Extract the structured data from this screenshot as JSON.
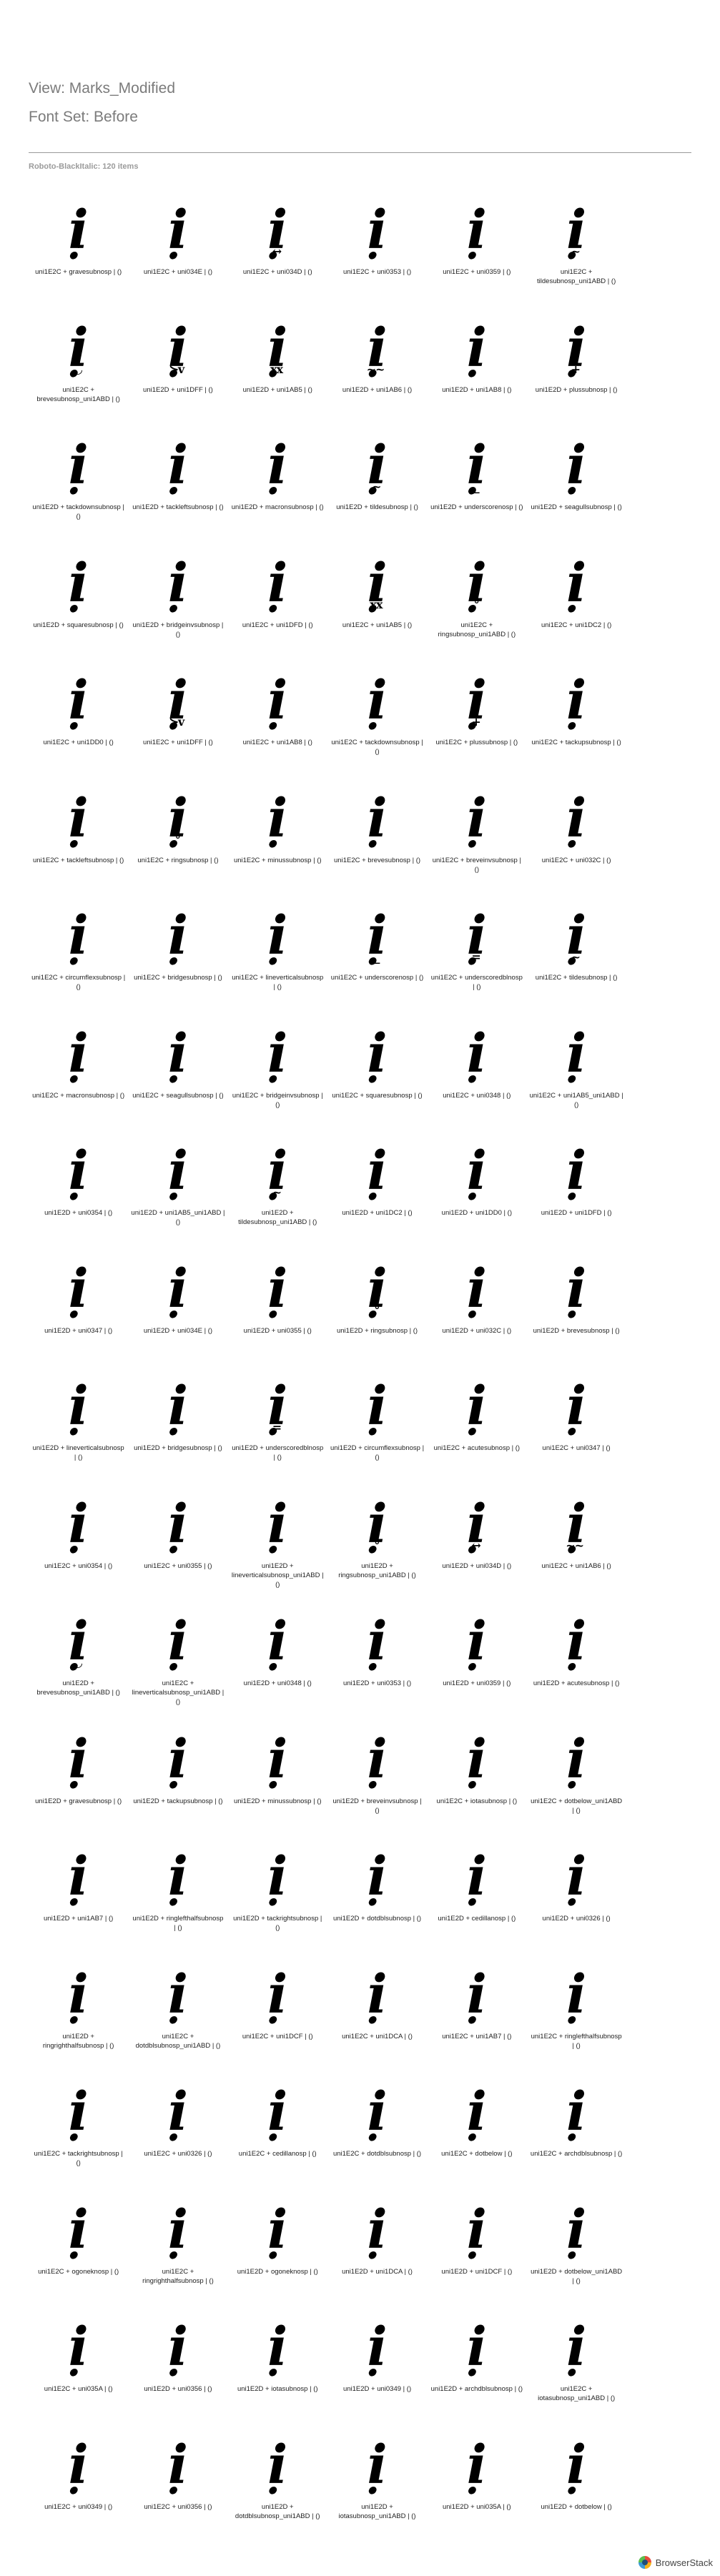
{
  "view_title": "View: Marks_Modified",
  "font_set": "Font Set: Before",
  "section_title": "Roboto-BlackItalic: 120 items",
  "footer": {
    "brand": "BrowserStack",
    "logo_icon": "browserstack-logo-icon"
  },
  "items": [
    {
      "base": "ị",
      "mark": "ˋ",
      "label": "uni1E2C + gravesubnosp | ()"
    },
    {
      "base": "ị",
      "mark": "",
      "label": "uni1E2C + uni034E | ()"
    },
    {
      "base": "ị",
      "mark": "↔",
      "label": "uni1E2C + uni034D | ()"
    },
    {
      "base": "ị",
      "mark": "",
      "label": "uni1E2C + uni0353 | ()"
    },
    {
      "base": "ị",
      "mark": "",
      "label": "uni1E2C + uni0359 | ()"
    },
    {
      "base": "ị",
      "mark": "~",
      "label": "uni1E2C + tildesubnosp_uni1ABD | ()"
    },
    {
      "base": "ị",
      "mark": "◡",
      "label": "uni1E2C + brevesubnosp_uni1ABD | ()"
    },
    {
      "base": "ị",
      "mark": "≻v",
      "label": "uni1E2D + uni1DFF | ()"
    },
    {
      "base": "ị",
      "mark": "xx",
      "label": "uni1E2D + uni1AB5 | ()"
    },
    {
      "base": "ị",
      "mark": "~~",
      "label": "uni1E2D + uni1AB6 | ()"
    },
    {
      "base": "ị",
      "mark": "",
      "label": "uni1E2D + uni1AB8 | ()"
    },
    {
      "base": "ị",
      "mark": "+",
      "label": "uni1E2D + plussubnosp | ()"
    },
    {
      "base": "ị",
      "mark": "",
      "label": "uni1E2D + tackdownsubnosp | ()"
    },
    {
      "base": "ị",
      "mark": "",
      "label": "uni1E2D + tackleftsubnosp | ()"
    },
    {
      "base": "ị",
      "mark": "",
      "label": "uni1E2D + macronsubnosp | ()"
    },
    {
      "base": "ị",
      "mark": "~",
      "label": "uni1E2D + tildesubnosp | ()"
    },
    {
      "base": "ị",
      "mark": "_",
      "label": "uni1E2D + underscorenosp | ()"
    },
    {
      "base": "ị",
      "mark": "",
      "label": "uni1E2D + seagullsubnosp | ()"
    },
    {
      "base": "ị",
      "mark": "",
      "label": "uni1E2D + squaresubnosp | ()"
    },
    {
      "base": "ị",
      "mark": "",
      "label": "uni1E2D + bridgeinvsubnosp | ()"
    },
    {
      "base": "ị",
      "mark": "",
      "label": "uni1E2C + uni1DFD | ()"
    },
    {
      "base": "ị",
      "mark": "xx",
      "label": "uni1E2C + uni1AB5 | ()"
    },
    {
      "base": "ị",
      "mark": "°",
      "label": "uni1E2C + ringsubnosp_uni1ABD | ()"
    },
    {
      "base": "ị",
      "mark": "",
      "label": "uni1E2C + uni1DC2 | ()"
    },
    {
      "base": "ị",
      "mark": "",
      "label": "uni1E2C + uni1DD0 | ()"
    },
    {
      "base": "ị",
      "mark": "≻v",
      "label": "uni1E2C + uni1DFF | ()"
    },
    {
      "base": "ị",
      "mark": "",
      "label": "uni1E2C + uni1AB8 | ()"
    },
    {
      "base": "ị",
      "mark": "",
      "label": "uni1E2C + tackdownsubnosp | ()"
    },
    {
      "base": "ị",
      "mark": "+",
      "label": "uni1E2C + plussubnosp | ()"
    },
    {
      "base": "ị",
      "mark": "",
      "label": "uni1E2C + tackupsubnosp | ()"
    },
    {
      "base": "ị",
      "mark": "",
      "label": "uni1E2C + tackleftsubnosp | ()"
    },
    {
      "base": "ị",
      "mark": "°",
      "label": "uni1E2C + ringsubnosp | ()"
    },
    {
      "base": "ị",
      "mark": "",
      "label": "uni1E2C + minussubnosp | ()"
    },
    {
      "base": "ị",
      "mark": "",
      "label": "uni1E2C + brevesubnosp | ()"
    },
    {
      "base": "ị",
      "mark": "",
      "label": "uni1E2C + breveinvsubnosp | ()"
    },
    {
      "base": "ị",
      "mark": "",
      "label": "uni1E2C + uni032C | ()"
    },
    {
      "base": "ị",
      "mark": "",
      "label": "uni1E2C + circumflexsubnosp | ()"
    },
    {
      "base": "ị",
      "mark": "",
      "label": "uni1E2C + bridgesubnosp | ()"
    },
    {
      "base": "ị",
      "mark": "",
      "label": "uni1E2C + lineverticalsubnosp | ()"
    },
    {
      "base": "ị",
      "mark": "_",
      "label": "uni1E2C + underscorenosp | ()"
    },
    {
      "base": "ị",
      "mark": "=",
      "label": "uni1E2C + underscoredblnosp | ()"
    },
    {
      "base": "ị",
      "mark": "~",
      "label": "uni1E2C + tildesubnosp | ()"
    },
    {
      "base": "ị",
      "mark": "",
      "label": "uni1E2C + macronsubnosp | ()"
    },
    {
      "base": "ị",
      "mark": "",
      "label": "uni1E2C + seagullsubnosp | ()"
    },
    {
      "base": "ị",
      "mark": "",
      "label": "uni1E2C + bridgeinvsubnosp | ()"
    },
    {
      "base": "ị",
      "mark": "",
      "label": "uni1E2C + squaresubnosp | ()"
    },
    {
      "base": "ị",
      "mark": "",
      "label": "uni1E2C + uni0348 | ()"
    },
    {
      "base": "ị",
      "mark": "",
      "label": "uni1E2C + uni1AB5_uni1ABD | ()"
    },
    {
      "base": "ị",
      "mark": "",
      "label": "uni1E2D + uni0354 | ()"
    },
    {
      "base": "ị",
      "mark": "",
      "label": "uni1E2D + uni1AB5_uni1ABD | ()"
    },
    {
      "base": "ị",
      "mark": "~",
      "label": "uni1E2D + tildesubnosp_uni1ABD | ()"
    },
    {
      "base": "ị",
      "mark": "",
      "label": "uni1E2D + uni1DC2 | ()"
    },
    {
      "base": "ị",
      "mark": "",
      "label": "uni1E2D + uni1DD0 | ()"
    },
    {
      "base": "ị",
      "mark": "",
      "label": "uni1E2D + uni1DFD | ()"
    },
    {
      "base": "ị",
      "mark": "",
      "label": "uni1E2D + uni0347 | ()"
    },
    {
      "base": "ị",
      "mark": "",
      "label": "uni1E2D + uni034E | ()"
    },
    {
      "base": "ị",
      "mark": "",
      "label": "uni1E2D + uni0355 | ()"
    },
    {
      "base": "ị",
      "mark": "°",
      "label": "uni1E2D + ringsubnosp | ()"
    },
    {
      "base": "ị",
      "mark": "",
      "label": "uni1E2D + uni032C | ()"
    },
    {
      "base": "ị",
      "mark": "",
      "label": "uni1E2D + brevesubnosp | ()"
    },
    {
      "base": "ị",
      "mark": "",
      "label": "uni1E2D + lineverticalsubnosp | ()"
    },
    {
      "base": "ị",
      "mark": "",
      "label": "uni1E2D + bridgesubnosp | ()"
    },
    {
      "base": "ị",
      "mark": "=",
      "label": "uni1E2D + underscoredblnosp | ()"
    },
    {
      "base": "ị",
      "mark": "",
      "label": "uni1E2D + circumflexsubnosp | ()"
    },
    {
      "base": "ị",
      "mark": "",
      "label": "uni1E2C + acutesubnosp | ()"
    },
    {
      "base": "ị",
      "mark": "",
      "label": "uni1E2C + uni0347 | ()"
    },
    {
      "base": "ị",
      "mark": "",
      "label": "uni1E2C + uni0354 | ()"
    },
    {
      "base": "ị",
      "mark": "",
      "label": "uni1E2C + uni0355 | ()"
    },
    {
      "base": "ị",
      "mark": "",
      "label": "uni1E2D + lineverticalsubnosp_uni1ABD | ()"
    },
    {
      "base": "ị",
      "mark": "°",
      "label": "uni1E2D + ringsubnosp_uni1ABD | ()"
    },
    {
      "base": "ị",
      "mark": "↔",
      "label": "uni1E2D + uni034D | ()"
    },
    {
      "base": "ị",
      "mark": "~~",
      "label": "uni1E2C + uni1AB6 | ()"
    },
    {
      "base": "ị",
      "mark": "◡",
      "label": "uni1E2D + brevesubnosp_uni1ABD | ()"
    },
    {
      "base": "ị",
      "mark": "",
      "label": "uni1E2C + lineverticalsubnosp_uni1ABD | ()"
    },
    {
      "base": "ị",
      "mark": "",
      "label": "uni1E2D + uni0348 | ()"
    },
    {
      "base": "ị",
      "mark": "",
      "label": "uni1E2D + uni0353 | ()"
    },
    {
      "base": "ị",
      "mark": "",
      "label": "uni1E2D + uni0359 | ()"
    },
    {
      "base": "ị",
      "mark": "",
      "label": "uni1E2D + acutesubnosp | ()"
    },
    {
      "base": "ị",
      "mark": "ˋ",
      "label": "uni1E2D + gravesubnosp | ()"
    },
    {
      "base": "ị",
      "mark": "",
      "label": "uni1E2D + tackupsubnosp | ()"
    },
    {
      "base": "ị",
      "mark": "",
      "label": "uni1E2D + minussubnosp | ()"
    },
    {
      "base": "ị",
      "mark": "",
      "label": "uni1E2D + breveinvsubnosp | ()"
    },
    {
      "base": "ị",
      "mark": "",
      "label": "uni1E2C + iotasubnosp | ()"
    },
    {
      "base": "ị",
      "mark": "",
      "label": "uni1E2C + dotbelow_uni1ABD | ()"
    },
    {
      "base": "ị",
      "mark": "",
      "label": "uni1E2D + uni1AB7 | ()"
    },
    {
      "base": "ị",
      "mark": "",
      "label": "uni1E2D + ringlefthalfsubnosp | ()"
    },
    {
      "base": "ị",
      "mark": "",
      "label": "uni1E2D + tackrightsubnosp | ()"
    },
    {
      "base": "ị",
      "mark": "",
      "label": "uni1E2D + dotdblsubnosp | ()"
    },
    {
      "base": "ị",
      "mark": "",
      "label": "uni1E2D + cedillanosp | ()"
    },
    {
      "base": "ị",
      "mark": "",
      "label": "uni1E2D + uni0326 | ()"
    },
    {
      "base": "ị",
      "mark": "",
      "label": "uni1E2D + ringrighthalfsubnosp | ()"
    },
    {
      "base": "ị",
      "mark": "",
      "label": "uni1E2C + dotdblsubnosp_uni1ABD | ()"
    },
    {
      "base": "ị",
      "mark": "",
      "label": "uni1E2C + uni1DCF | ()"
    },
    {
      "base": "ị",
      "mark": "",
      "label": "uni1E2C + uni1DCA | ()"
    },
    {
      "base": "ị",
      "mark": "",
      "label": "uni1E2C + uni1AB7 | ()"
    },
    {
      "base": "ị",
      "mark": "",
      "label": "uni1E2C + ringlefthalfsubnosp | ()"
    },
    {
      "base": "ị",
      "mark": "",
      "label": "uni1E2C + tackrightsubnosp | ()"
    },
    {
      "base": "ị",
      "mark": "",
      "label": "uni1E2C + uni0326 | ()"
    },
    {
      "base": "ị",
      "mark": "",
      "label": "uni1E2C + cedillanosp | ()"
    },
    {
      "base": "ị",
      "mark": "",
      "label": "uni1E2C + dotdblsubnosp | ()"
    },
    {
      "base": "ị",
      "mark": "",
      "label": "uni1E2C + dotbelow | ()"
    },
    {
      "base": "ị",
      "mark": "",
      "label": "uni1E2C + archdblsubnosp | ()"
    },
    {
      "base": "ị",
      "mark": "",
      "label": "uni1E2C + ogoneknosp | ()"
    },
    {
      "base": "ị",
      "mark": "",
      "label": "uni1E2C + ringrighthalfsubnosp | ()"
    },
    {
      "base": "ị",
      "mark": "",
      "label": "uni1E2D + ogoneknosp | ()"
    },
    {
      "base": "ị",
      "mark": "",
      "label": "uni1E2D + uni1DCA | ()"
    },
    {
      "base": "ị",
      "mark": "",
      "label": "uni1E2D + uni1DCF | ()"
    },
    {
      "base": "ị",
      "mark": "",
      "label": "uni1E2D + dotbelow_uni1ABD | ()"
    },
    {
      "base": "ị",
      "mark": "",
      "label": "uni1E2C + uni035A | ()"
    },
    {
      "base": "ị",
      "mark": "",
      "label": "uni1E2D + uni0356 | ()"
    },
    {
      "base": "ị",
      "mark": "",
      "label": "uni1E2D + iotasubnosp | ()"
    },
    {
      "base": "ị",
      "mark": "",
      "label": "uni1E2D + uni0349 | ()"
    },
    {
      "base": "ị",
      "mark": "",
      "label": "uni1E2D + archdblsubnosp | ()"
    },
    {
      "base": "ị",
      "mark": "",
      "label": "uni1E2C + iotasubnosp_uni1ABD | ()"
    },
    {
      "base": "ị",
      "mark": "",
      "label": "uni1E2C + uni0349 | ()"
    },
    {
      "base": "ị",
      "mark": "",
      "label": "uni1E2C + uni0356 | ()"
    },
    {
      "base": "ị",
      "mark": "",
      "label": "uni1E2D + dotdblsubnosp_uni1ABD | ()"
    },
    {
      "base": "ị",
      "mark": "",
      "label": "uni1E2D + iotasubnosp_uni1ABD | ()"
    },
    {
      "base": "ị",
      "mark": "",
      "label": "uni1E2D + uni035A | ()"
    },
    {
      "base": "ị",
      "mark": "",
      "label": "uni1E2D + dotbelow | ()"
    }
  ]
}
